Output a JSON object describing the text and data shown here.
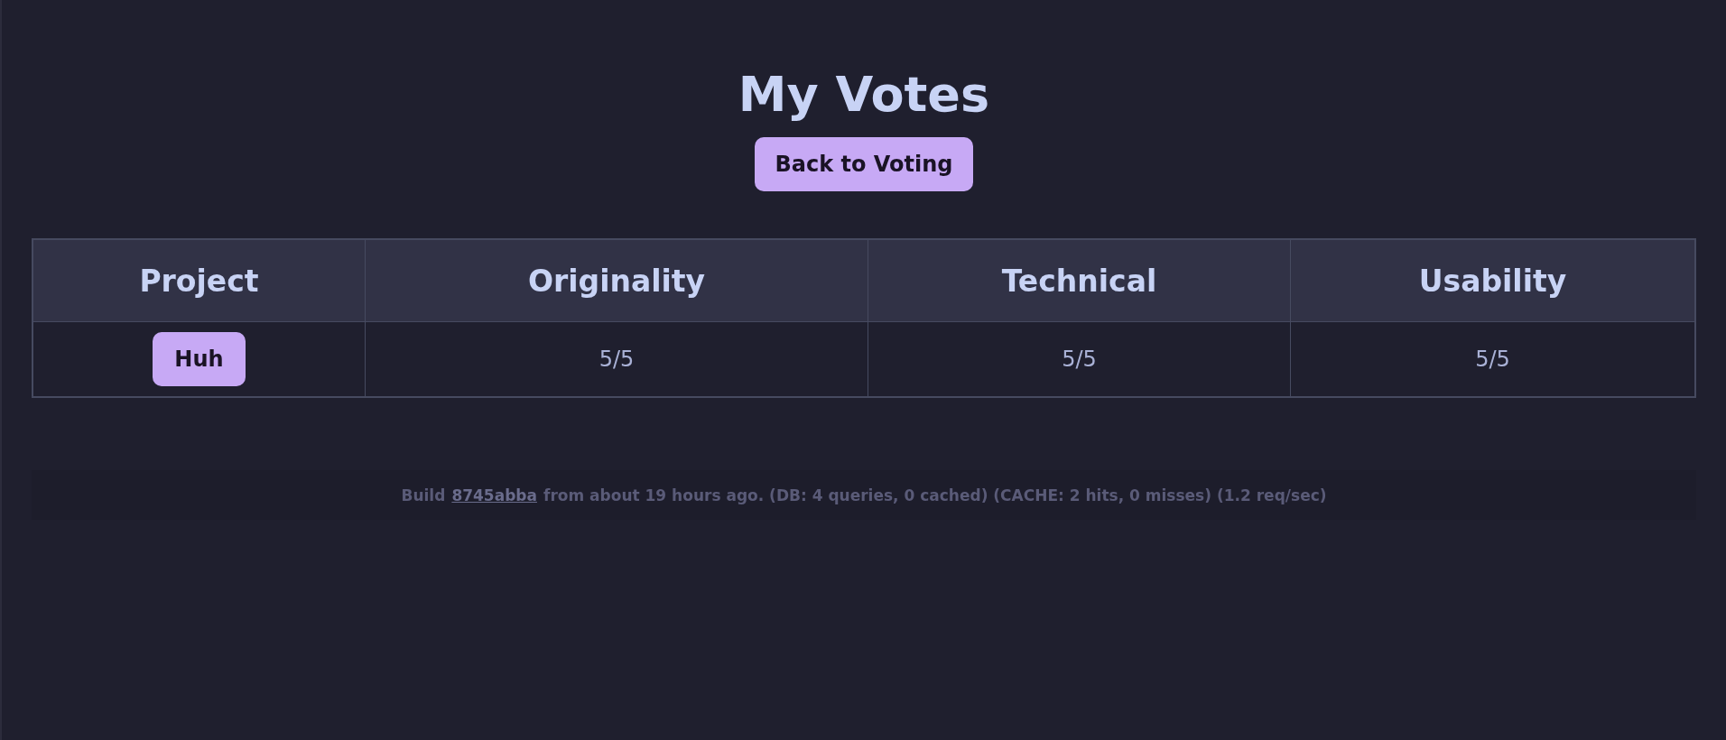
{
  "title": "My Votes",
  "back_button": "Back to Voting",
  "table": {
    "columns": [
      "Project",
      "Originality",
      "Technical",
      "Usability"
    ],
    "rows": [
      {
        "project": "Huh",
        "scores": [
          "5/5",
          "5/5",
          "5/5"
        ]
      }
    ]
  },
  "footer": {
    "prefix": "Build",
    "build_link": "8745abba",
    "rest": "from about 19 hours ago. (DB: 4 queries, 0 cached) (CACHE: 2 hits, 0 misses) (1.2 req/sec)"
  }
}
